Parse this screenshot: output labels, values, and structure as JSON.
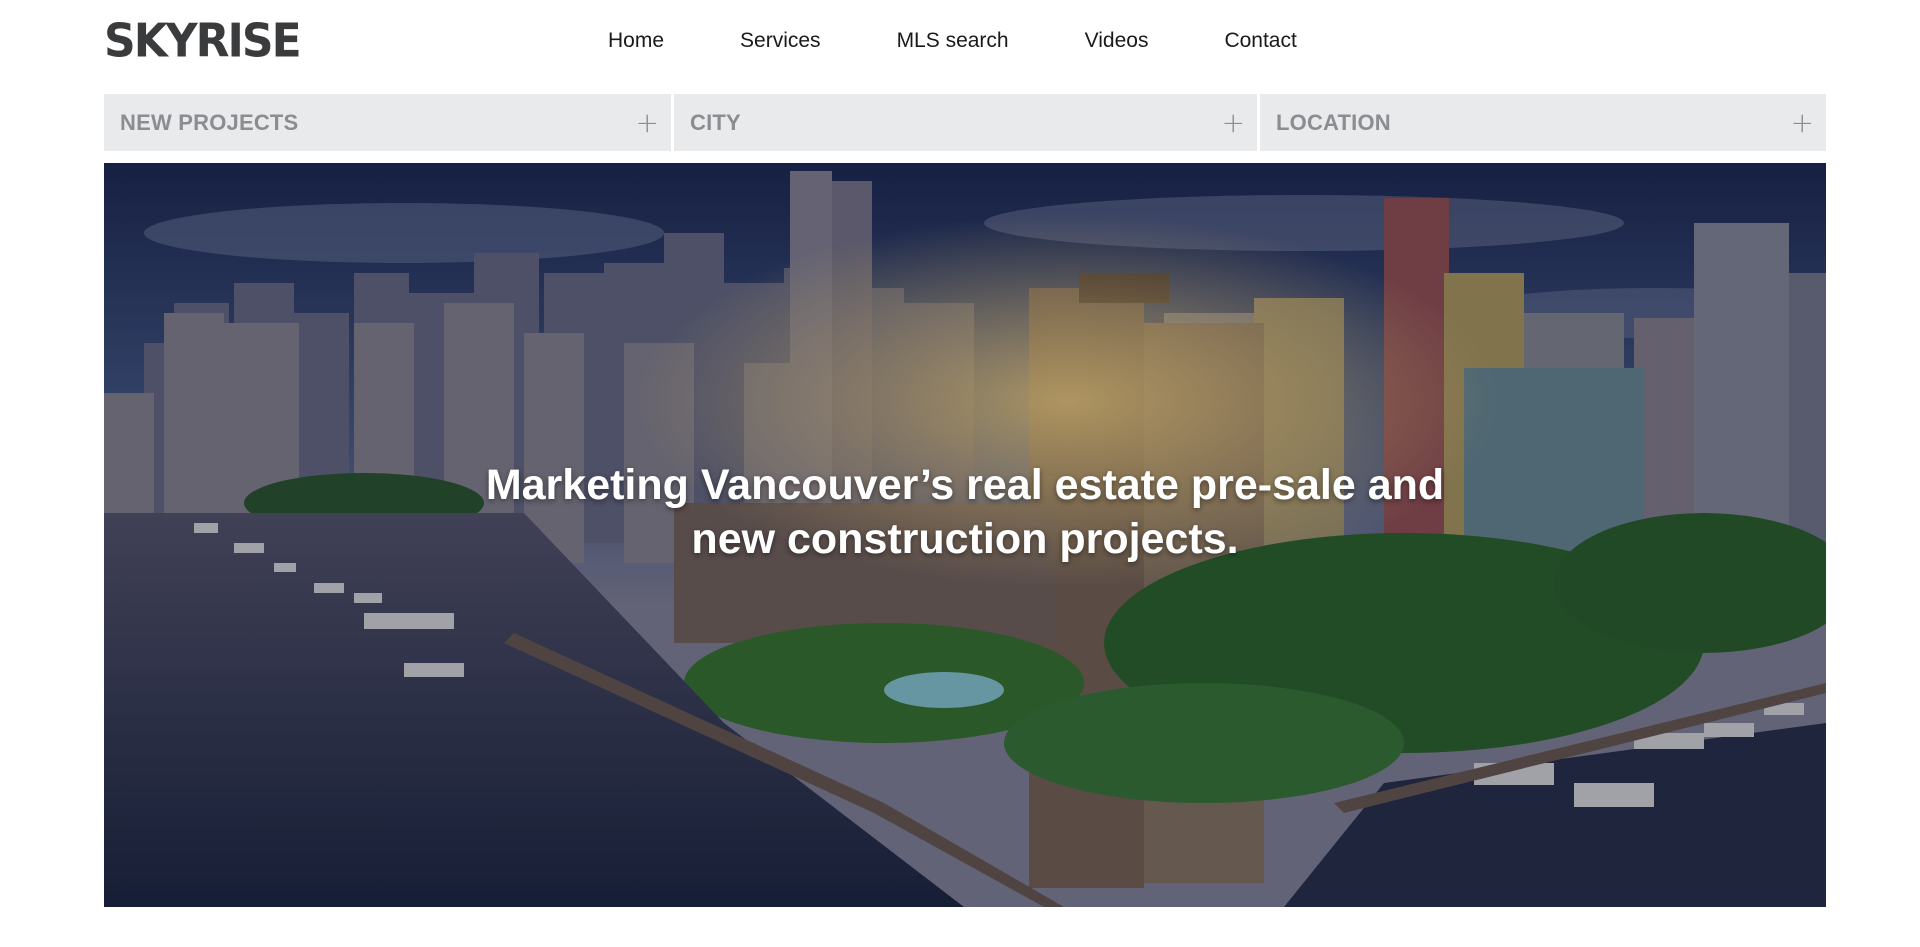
{
  "header": {
    "logo_text": "SKYRISE",
    "nav": [
      {
        "label": "Home"
      },
      {
        "label": "Services"
      },
      {
        "label": "MLS search"
      },
      {
        "label": "Videos"
      },
      {
        "label": "Contact"
      }
    ]
  },
  "filters": [
    {
      "label": "NEW PROJECTS",
      "icon": "plus-icon",
      "symbol": "+"
    },
    {
      "label": "CITY",
      "icon": "plus-icon",
      "symbol": "+"
    },
    {
      "label": "LOCATION",
      "icon": "plus-icon",
      "symbol": "+"
    }
  ],
  "hero": {
    "title": "Marketing Vancouver’s real estate pre-sale and new construction projects.",
    "image_subject": "Vancouver skyline and Coal Harbour marina aerial photo"
  },
  "colors": {
    "logo": "#3a3b3d",
    "filter_bg": "#e9eaeb",
    "filter_text": "#8a8d91",
    "hero_text": "#ffffff"
  }
}
